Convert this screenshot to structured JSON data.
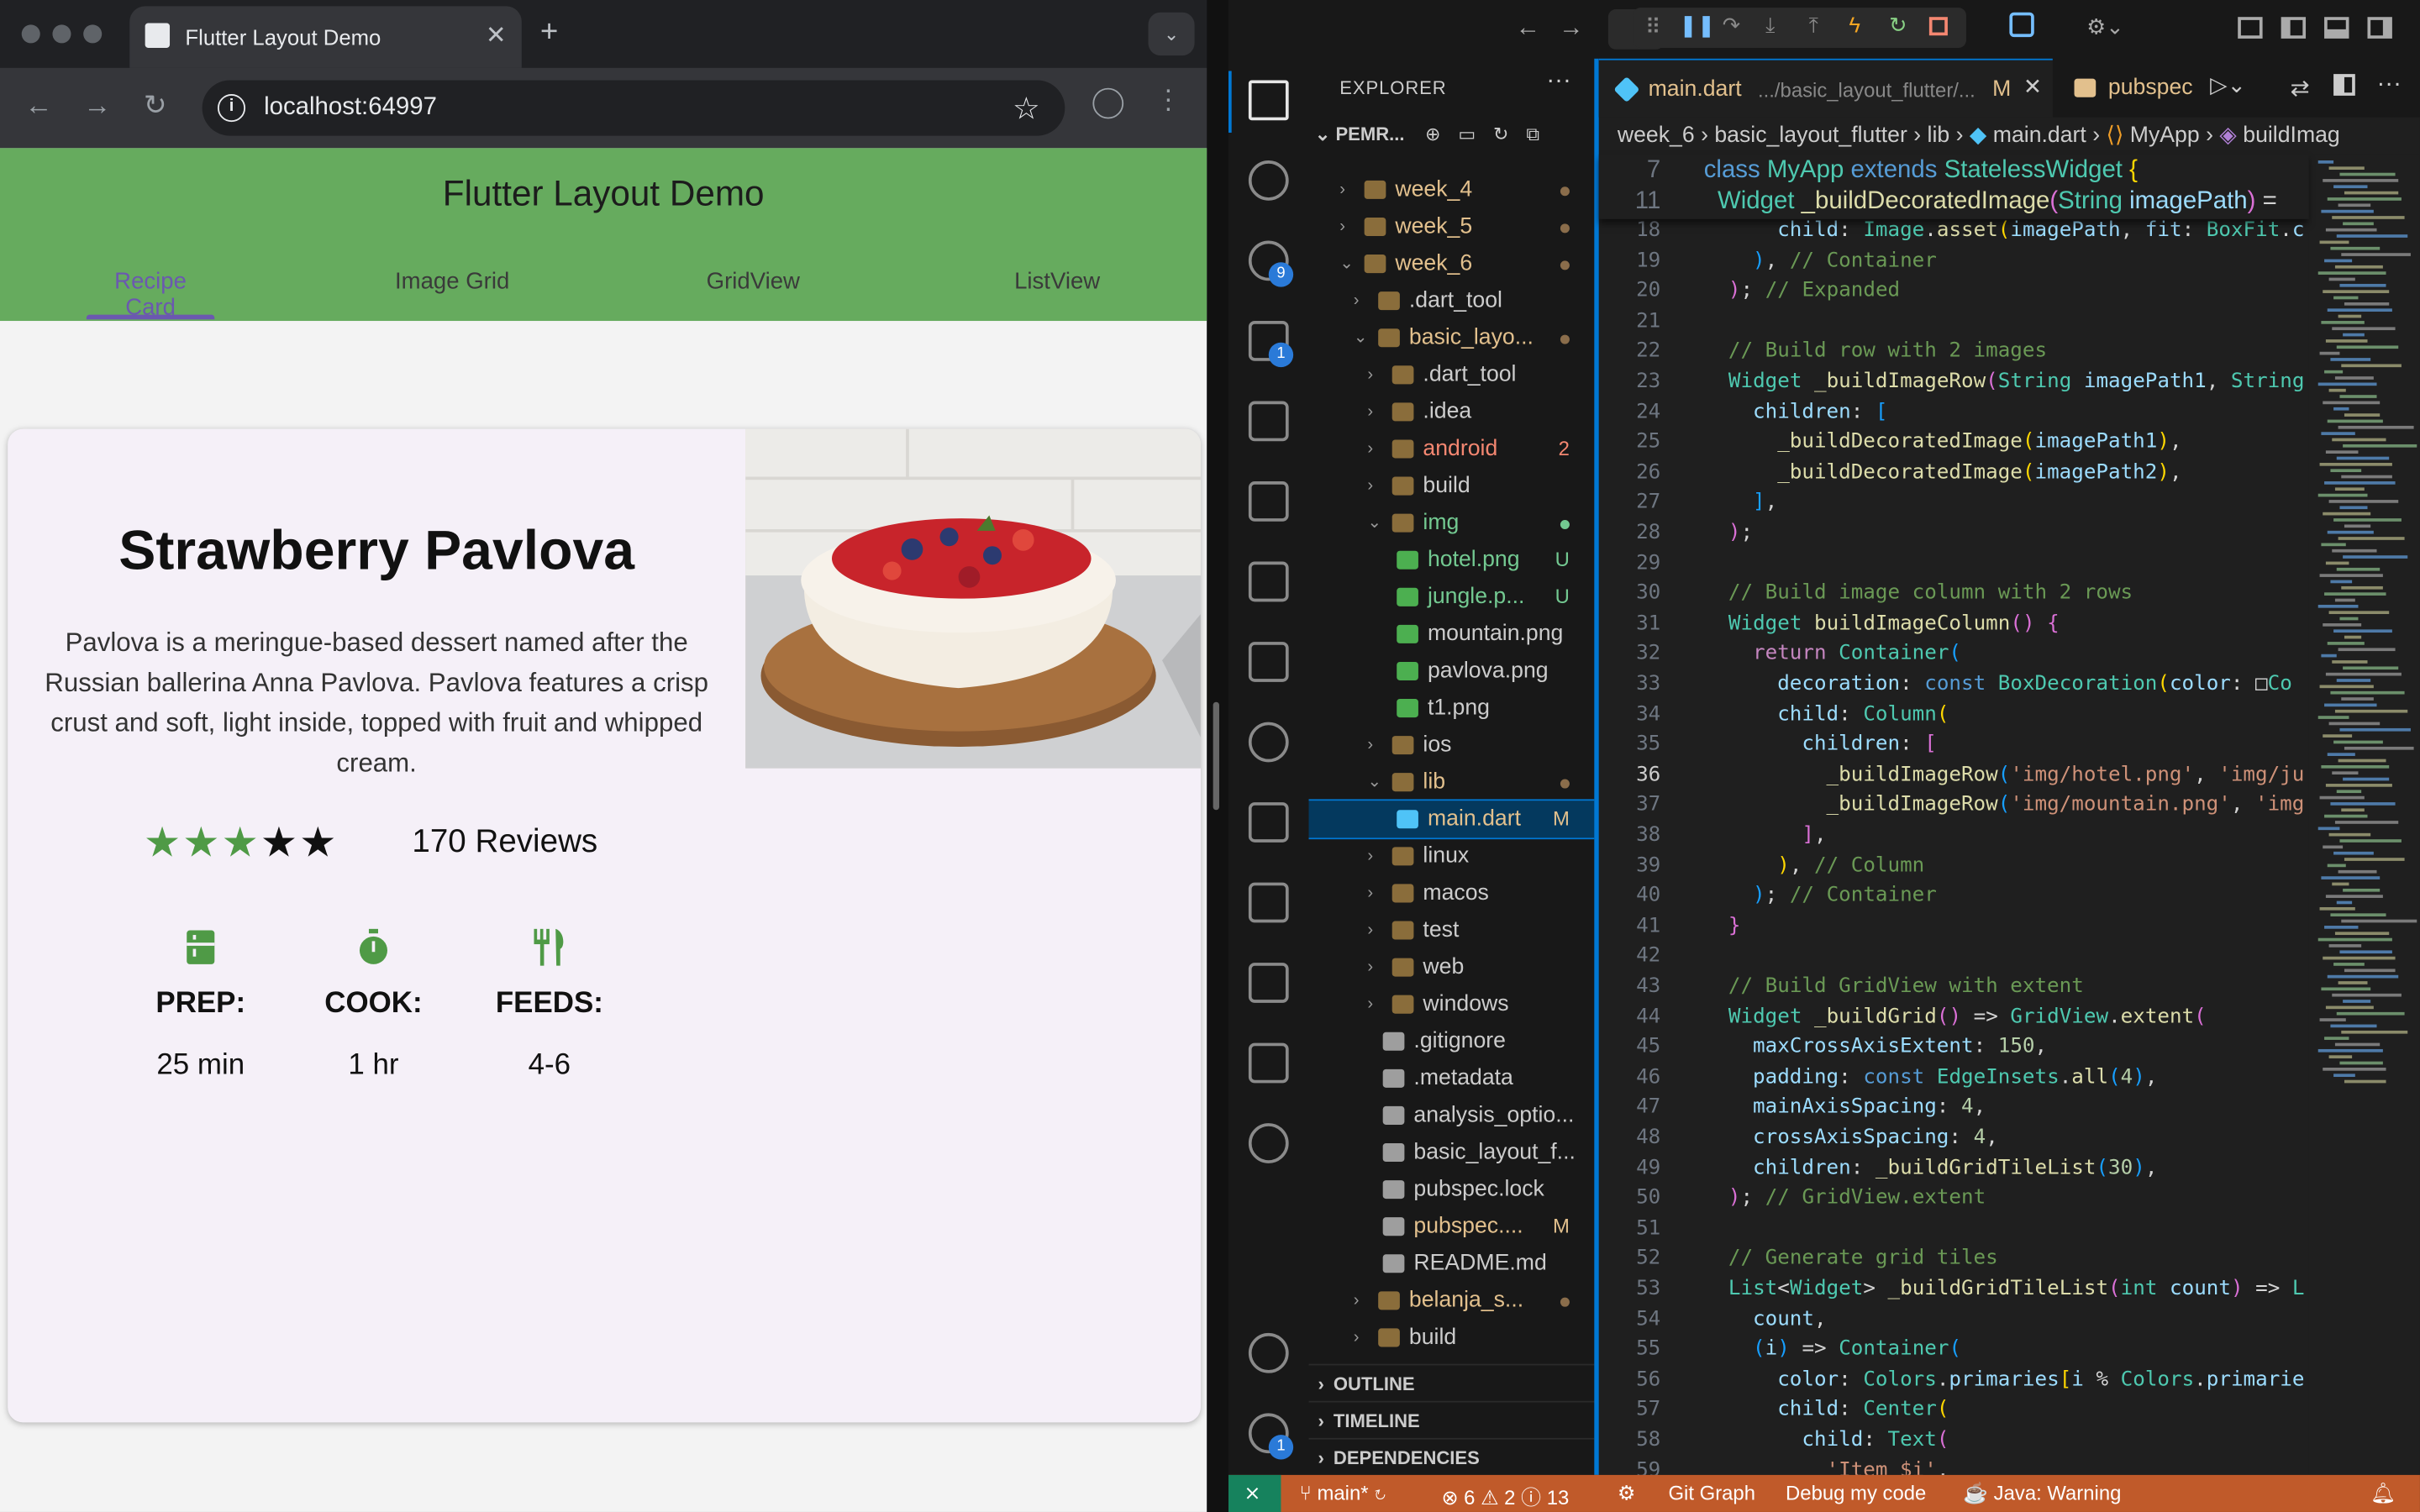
{
  "browser": {
    "tab_title": "Flutter Layout Demo",
    "new_tab_symbol": "+",
    "url": "localhost:64997"
  },
  "app": {
    "title": "Flutter Layout Demo",
    "tabs": [
      {
        "label": "Recipe Card",
        "active": true
      },
      {
        "label": "Image Grid",
        "active": false
      },
      {
        "label": "GridView",
        "active": false
      },
      {
        "label": "ListView",
        "active": false
      }
    ],
    "recipe": {
      "name": "Strawberry Pavlova",
      "description": "Pavlova is a meringue-based dessert named after the Russian ballerina Anna Pavlova. Pavlova features a crisp crust and soft, light inside, topped with fruit and whipped cream.",
      "rating": 3,
      "rating_max": 5,
      "reviews": "170 Reviews",
      "info": [
        {
          "icon": "kitchen-icon",
          "label": "PREP:",
          "value": "25 min"
        },
        {
          "icon": "timer-icon",
          "label": "COOK:",
          "value": "1 hr"
        },
        {
          "icon": "restaurant-icon",
          "label": "FEEDS:",
          "value": "4-6"
        }
      ]
    }
  },
  "vscode": {
    "explorer_title": "EXPLORER",
    "explorer_more": "···",
    "project_label": "PEMR...",
    "tree": [
      {
        "name": "week_4",
        "indent": 0,
        "type": "folder",
        "expanded": false,
        "color": "#e2c08d",
        "decor": "dot"
      },
      {
        "name": "week_5",
        "indent": 0,
        "type": "folder",
        "expanded": false,
        "color": "#e2c08d",
        "decor": "dot"
      },
      {
        "name": "week_6",
        "indent": 0,
        "type": "folder",
        "expanded": true,
        "color": "#e2c08d",
        "decor": "dot"
      },
      {
        "name": ".dart_tool",
        "indent": 1,
        "type": "folder",
        "expanded": false,
        "color": "#cccccc",
        "decor": ""
      },
      {
        "name": "basic_layo...",
        "indent": 1,
        "type": "folder",
        "expanded": true,
        "color": "#e2c08d",
        "decor": "dot"
      },
      {
        "name": ".dart_tool",
        "indent": 2,
        "type": "folder",
        "expanded": false,
        "color": "#cccccc",
        "decor": ""
      },
      {
        "name": ".idea",
        "indent": 2,
        "type": "folder",
        "expanded": false,
        "color": "#cccccc",
        "decor": ""
      },
      {
        "name": "android",
        "indent": 2,
        "type": "folder",
        "expanded": false,
        "color": "#f48771",
        "decor": "2"
      },
      {
        "name": "build",
        "indent": 2,
        "type": "folder",
        "expanded": false,
        "color": "#cccccc",
        "decor": ""
      },
      {
        "name": "img",
        "indent": 2,
        "type": "folder",
        "expanded": true,
        "color": "#73c991",
        "decor": "greendot"
      },
      {
        "name": "hotel.png",
        "indent": 3,
        "type": "image",
        "color": "#73c991",
        "decor": "U"
      },
      {
        "name": "jungle.p...",
        "indent": 3,
        "type": "image",
        "color": "#73c991",
        "decor": "U"
      },
      {
        "name": "mountain.png",
        "indent": 3,
        "type": "image",
        "color": "#cccccc",
        "decor": ""
      },
      {
        "name": "pavlova.png",
        "indent": 3,
        "type": "image",
        "color": "#cccccc",
        "decor": ""
      },
      {
        "name": "t1.png",
        "indent": 3,
        "type": "image",
        "color": "#cccccc",
        "decor": ""
      },
      {
        "name": "ios",
        "indent": 2,
        "type": "folder",
        "expanded": false,
        "color": "#cccccc",
        "decor": ""
      },
      {
        "name": "lib",
        "indent": 2,
        "type": "folder",
        "expanded": true,
        "color": "#e2c08d",
        "decor": "dot"
      },
      {
        "name": "main.dart",
        "indent": 3,
        "type": "dart",
        "color": "#e2c08d",
        "decor": "M",
        "selected": true
      },
      {
        "name": "linux",
        "indent": 2,
        "type": "folder",
        "expanded": false,
        "color": "#cccccc",
        "decor": ""
      },
      {
        "name": "macos",
        "indent": 2,
        "type": "folder",
        "expanded": false,
        "color": "#cccccc",
        "decor": ""
      },
      {
        "name": "test",
        "indent": 2,
        "type": "folder",
        "expanded": false,
        "color": "#cccccc",
        "decor": ""
      },
      {
        "name": "web",
        "indent": 2,
        "type": "folder",
        "expanded": false,
        "color": "#cccccc",
        "decor": ""
      },
      {
        "name": "windows",
        "indent": 2,
        "type": "folder",
        "expanded": false,
        "color": "#cccccc",
        "decor": ""
      },
      {
        "name": ".gitignore",
        "indent": 2,
        "type": "file",
        "color": "#cccccc",
        "decor": ""
      },
      {
        "name": ".metadata",
        "indent": 2,
        "type": "file",
        "color": "#cccccc",
        "decor": ""
      },
      {
        "name": "analysis_optio...",
        "indent": 2,
        "type": "file",
        "color": "#cccccc",
        "decor": ""
      },
      {
        "name": "basic_layout_f...",
        "indent": 2,
        "type": "file",
        "color": "#cccccc",
        "decor": ""
      },
      {
        "name": "pubspec.lock",
        "indent": 2,
        "type": "file",
        "color": "#cccccc",
        "decor": ""
      },
      {
        "name": "pubspec....",
        "indent": 2,
        "type": "file",
        "color": "#e2c08d",
        "decor": "M"
      },
      {
        "name": "README.md",
        "indent": 2,
        "type": "file",
        "color": "#cccccc",
        "decor": ""
      },
      {
        "name": "belanja_s...",
        "indent": 1,
        "type": "folder",
        "expanded": false,
        "color": "#e2c08d",
        "decor": "dot"
      },
      {
        "name": "build",
        "indent": 1,
        "type": "folder",
        "expanded": false,
        "color": "#cccccc",
        "decor": ""
      }
    ],
    "sections": [
      "OUTLINE",
      "TIMELINE",
      "DEPENDENCIES"
    ],
    "editor_tabs": [
      {
        "name": "main.dart",
        "path": ".../basic_layout_flutter/...",
        "status": "M",
        "active": true
      },
      {
        "name": "pubspec",
        "active": false
      }
    ],
    "breadcrumbs": [
      "week_6",
      "basic_layout_flutter",
      "lib",
      "main.dart",
      "MyApp",
      "buildImag"
    ],
    "sticky_lines": [
      {
        "num": "7",
        "html": "<span class='k'>class</span> <span class='ty'>MyApp</span> <span class='k'>extends</span> <span class='ty'>StatelessWidget</span> <span class='b1'>{</span>"
      },
      {
        "num": "11",
        "html": "  <span class='ty'>Widget</span> <span class='fn'>_buildDecoratedImage</span><span class='b2'>(</span><span class='ty'>String</span> <span class='p'>imagePath</span><span class='b2'>)</span> ="
      }
    ],
    "code_lines": [
      {
        "num": "18",
        "html": "      <span class='p'>child</span>: <span class='ty'>Image</span>.<span class='fn'>asset</span><span class='b1'>(</span><span class='p'>imagePath</span>, <span class='p'>fit</span>: <span class='ty'>BoxFit</span>.<span class='p'>c</span>"
      },
      {
        "num": "19",
        "html": "    <span class='b3'>)</span>, <span class='c'>// Container</span>"
      },
      {
        "num": "20",
        "html": "  <span class='b2'>)</span>; <span class='c'>// Expanded</span>"
      },
      {
        "num": "21",
        "html": ""
      },
      {
        "num": "22",
        "html": "  <span class='c'>// Build row with 2 images</span>"
      },
      {
        "num": "23",
        "html": "  <span class='ty'>Widget</span> <span class='fn'>_buildImageRow</span><span class='b2'>(</span><span class='ty'>String</span> <span class='p'>imagePath1</span>, <span class='ty'>String</span>"
      },
      {
        "num": "24",
        "html": "    <span class='p'>children</span>: <span class='b3'>[</span>"
      },
      {
        "num": "25",
        "html": "      <span class='fn'>_buildDecoratedImage</span><span class='b1'>(</span><span class='p'>imagePath1</span><span class='b1'>)</span>,"
      },
      {
        "num": "26",
        "html": "      <span class='fn'>_buildDecoratedImage</span><span class='b1'>(</span><span class='p'>imagePath2</span><span class='b1'>)</span>,"
      },
      {
        "num": "27",
        "html": "    <span class='b3'>]</span>,"
      },
      {
        "num": "28",
        "html": "  <span class='b2'>)</span>;"
      },
      {
        "num": "29",
        "html": ""
      },
      {
        "num": "30",
        "html": "  <span class='c'>// Build image column with 2 rows</span>"
      },
      {
        "num": "31",
        "html": "  <span class='ty'>Widget</span> <span class='fn'>buildImageColumn</span><span class='b2'>()</span> <span class='b2'>{</span>"
      },
      {
        "num": "32",
        "html": "    <span class='kc'>return</span> <span class='ty'>Container</span><span class='b3'>(</span>"
      },
      {
        "num": "33",
        "html": "      <span class='p'>decoration</span>: <span class='k'>const</span> <span class='ty'>BoxDecoration</span><span class='b1'>(</span><span class='p'>color</span>: □<span class='ty'>Co</span>"
      },
      {
        "num": "34",
        "html": "      <span class='p'>child</span>: <span class='ty'>Column</span><span class='b1'>(</span>"
      },
      {
        "num": "35",
        "html": "        <span class='p'>children</span>: <span class='b2'>[</span>"
      },
      {
        "num": "36",
        "html": "          <span class='fn'>_buildImageRow</span><span class='b3'>(</span><span class='s'>'img/hotel.png'</span>, <span class='s'>'img/ju</span>"
      },
      {
        "num": "37",
        "html": "          <span class='fn'>_buildImageRow</span><span class='b3'>(</span><span class='s'>'img/mountain.png'</span>, <span class='s'>'img</span>"
      },
      {
        "num": "38",
        "html": "        <span class='b2'>]</span>,"
      },
      {
        "num": "39",
        "html": "      <span class='b1'>)</span>, <span class='c'>// Column</span>"
      },
      {
        "num": "40",
        "html": "    <span class='b3'>)</span>; <span class='c'>// Container</span>"
      },
      {
        "num": "41",
        "html": "  <span class='b2'>}</span>"
      },
      {
        "num": "42",
        "html": ""
      },
      {
        "num": "43",
        "html": "  <span class='c'>// Build GridView with extent</span>"
      },
      {
        "num": "44",
        "html": "  <span class='ty'>Widget</span> <span class='fn'>_buildGrid</span><span class='b2'>()</span> =&gt; <span class='ty'>GridView</span>.<span class='fn'>extent</span><span class='b2'>(</span>"
      },
      {
        "num": "45",
        "html": "    <span class='p'>maxCrossAxisExtent</span>: <span class='n'>150</span>,"
      },
      {
        "num": "46",
        "html": "    <span class='p'>padding</span>: <span class='k'>const</span> <span class='ty'>EdgeInsets</span>.<span class='fn'>all</span><span class='b3'>(</span><span class='n'>4</span><span class='b3'>)</span>,"
      },
      {
        "num": "47",
        "html": "    <span class='p'>mainAxisSpacing</span>: <span class='n'>4</span>,"
      },
      {
        "num": "48",
        "html": "    <span class='p'>crossAxisSpacing</span>: <span class='n'>4</span>,"
      },
      {
        "num": "49",
        "html": "    <span class='p'>children</span>: <span class='fn'>_buildGridTileList</span><span class='b3'>(</span><span class='n'>30</span><span class='b3'>)</span>,"
      },
      {
        "num": "50",
        "html": "  <span class='b2'>)</span>; <span class='c'>// GridView.extent</span>"
      },
      {
        "num": "51",
        "html": ""
      },
      {
        "num": "52",
        "html": "  <span class='c'>// Generate grid tiles</span>"
      },
      {
        "num": "53",
        "html": "  <span class='ty'>List</span>&lt;<span class='ty'>Widget</span>&gt; <span class='fn'>_buildGridTileList</span><span class='b2'>(</span><span class='ty'>int</span> <span class='p'>count</span><span class='b2'>)</span> =&gt; <span class='ty'>L</span>"
      },
      {
        "num": "54",
        "html": "    <span class='p'>count</span>,"
      },
      {
        "num": "55",
        "html": "    <span class='b3'>(</span><span class='p'>i</span><span class='b3'>)</span> =&gt; <span class='ty'>Container</span><span class='b3'>(</span>"
      },
      {
        "num": "56",
        "html": "      <span class='p'>color</span>: <span class='ty'>Colors</span>.<span class='p'>primaries</span><span class='b1'>[</span><span class='p'>i</span> % <span class='ty'>Colors</span>.<span class='p'>primarie</span>"
      },
      {
        "num": "57",
        "html": "      <span class='p'>child</span>: <span class='ty'>Center</span><span class='b1'>(</span>"
      },
      {
        "num": "58",
        "html": "        <span class='p'>child</span>: <span class='ty'>Text</span><span class='b2'>(</span>"
      },
      {
        "num": "59",
        "html": "          <span class='s'>'Item $i'</span>,"
      }
    ],
    "current_line": "36",
    "status": {
      "branch": "main*",
      "errors": "6",
      "warnings": "2",
      "info": "13",
      "git_graph": "Git Graph",
      "debug": "Debug my code",
      "java": "Java: Warning"
    },
    "badges": {
      "scm": "9",
      "debug": "1",
      "manage": "1"
    }
  }
}
